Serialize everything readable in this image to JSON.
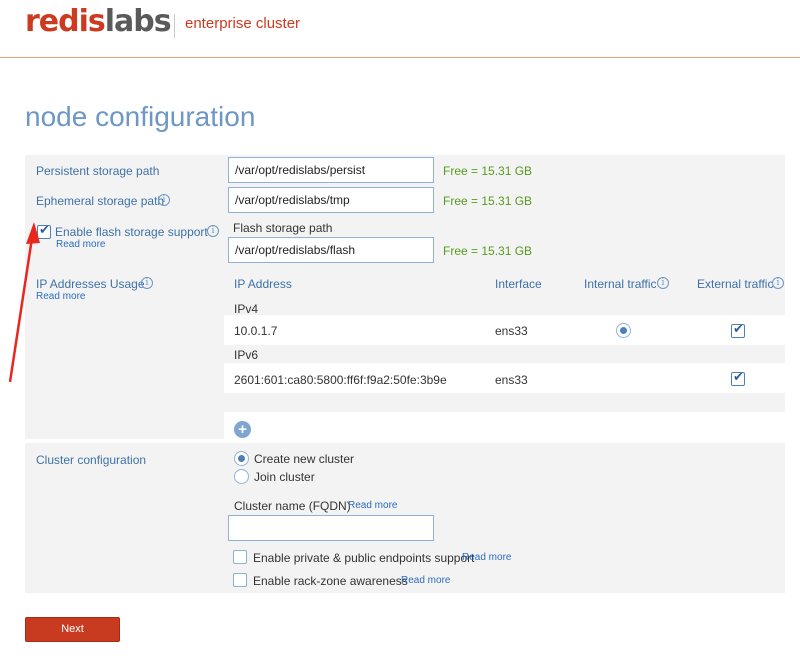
{
  "header": {
    "logo_part1": "redis",
    "logo_part2": "labs",
    "subtitle": "enterprise cluster"
  },
  "page": {
    "title": "node configuration"
  },
  "persistent": {
    "label": "Persistent storage path",
    "value": "/var/opt/redislabs/persist",
    "free": "Free = 15.31 GB"
  },
  "ephemeral": {
    "label": "Ephemeral storage path",
    "value": "/var/opt/redislabs/tmp",
    "free": "Free = 15.31 GB"
  },
  "flash": {
    "checkbox_label": "Enable flash storage support",
    "checked": true,
    "read_more": "Read more",
    "path_label": "Flash storage path",
    "value": "/var/opt/redislabs/flash",
    "free": "Free = 15.31 GB"
  },
  "ip": {
    "label": "IP Addresses Usage",
    "read_more": "Read more",
    "columns": [
      "IP Address",
      "Interface",
      "Internal traffic",
      "External traffic"
    ],
    "ipv4": {
      "group_label": "IPv4",
      "address": "10.0.1.7",
      "interface": "ens33",
      "internal": true,
      "external": true
    },
    "ipv6": {
      "group_label": "IPv6",
      "address": "2601:601:ca80:5800:ff6f:f9a2:50fe:3b9e",
      "interface": "ens33",
      "internal": false,
      "external": true
    },
    "add_icon": "plus-icon"
  },
  "cluster": {
    "label": "Cluster configuration",
    "options": [
      "Create new cluster",
      "Join cluster"
    ],
    "selected": "Create new cluster",
    "name_label": "Cluster name (FQDN)",
    "name_read_more": "Read more",
    "name_value": "",
    "endpoints_label": "Enable private & public endpoints support",
    "endpoints_read_more": "Read more",
    "rackzone_label": "Enable rack-zone awareness",
    "rackzone_read_more": "Read more"
  },
  "actions": {
    "next_label": "Next"
  },
  "colors": {
    "brand_red": "#cc3a20",
    "accent_blue": "#6d97c6",
    "free_green": "#5a9a1e",
    "annotation_arrow": "#e8281e"
  }
}
